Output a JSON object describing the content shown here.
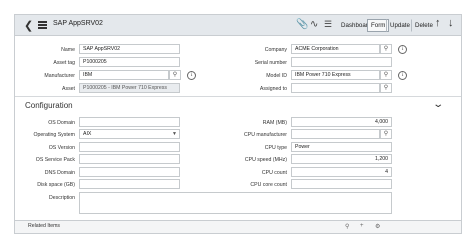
{
  "header": {
    "back_icon": "chevron-left-icon",
    "menu_icon": "hamburger-icon",
    "title": "SAP AppSRV02",
    "buttons": {
      "dashboard": "Dashboard",
      "form": "Form",
      "update": "Update",
      "delete": "Delete"
    }
  },
  "fields": {
    "name": {
      "label": "Name",
      "value": "SAP AppSRV02"
    },
    "asset_tag": {
      "label": "Asset tag",
      "value": "P1000205"
    },
    "manufacturer": {
      "label": "Manufacturer",
      "value": "IBM"
    },
    "asset": {
      "label": "Asset",
      "value": "P1000205 - IBM Power 710 Express"
    },
    "company": {
      "label": "Company",
      "value": "ACME Corporation"
    },
    "serial_number": {
      "label": "Serial number",
      "value": ""
    },
    "model_id": {
      "label": "Model ID",
      "value": "IBM Power 710 Express"
    },
    "assigned_to": {
      "label": "Assigned to",
      "value": ""
    }
  },
  "configuration": {
    "title": "Configuration",
    "os_domain": {
      "label": "OS Domain",
      "value": ""
    },
    "operating_system": {
      "label": "Operating System",
      "value": "AIX"
    },
    "os_version": {
      "label": "OS Version",
      "value": ""
    },
    "os_service_pack": {
      "label": "OS Service Pack",
      "value": ""
    },
    "dns_domain": {
      "label": "DNS Domain",
      "value": ""
    },
    "disk_space": {
      "label": "Disk space (GB)",
      "value": ""
    },
    "description": {
      "label": "Description",
      "value": ""
    },
    "ram": {
      "label": "RAM (MB)",
      "value": "4,000"
    },
    "cpu_manufacturer": {
      "label": "CPU manufacturer",
      "value": ""
    },
    "cpu_type": {
      "label": "CPU type",
      "value": "Power"
    },
    "cpu_speed": {
      "label": "CPU speed (MHz)",
      "value": "1,200"
    },
    "cpu_count": {
      "label": "CPU count",
      "value": "4"
    },
    "cpu_core_count": {
      "label": "CPU core count",
      "value": ""
    }
  },
  "related": {
    "title": "Related Items"
  }
}
